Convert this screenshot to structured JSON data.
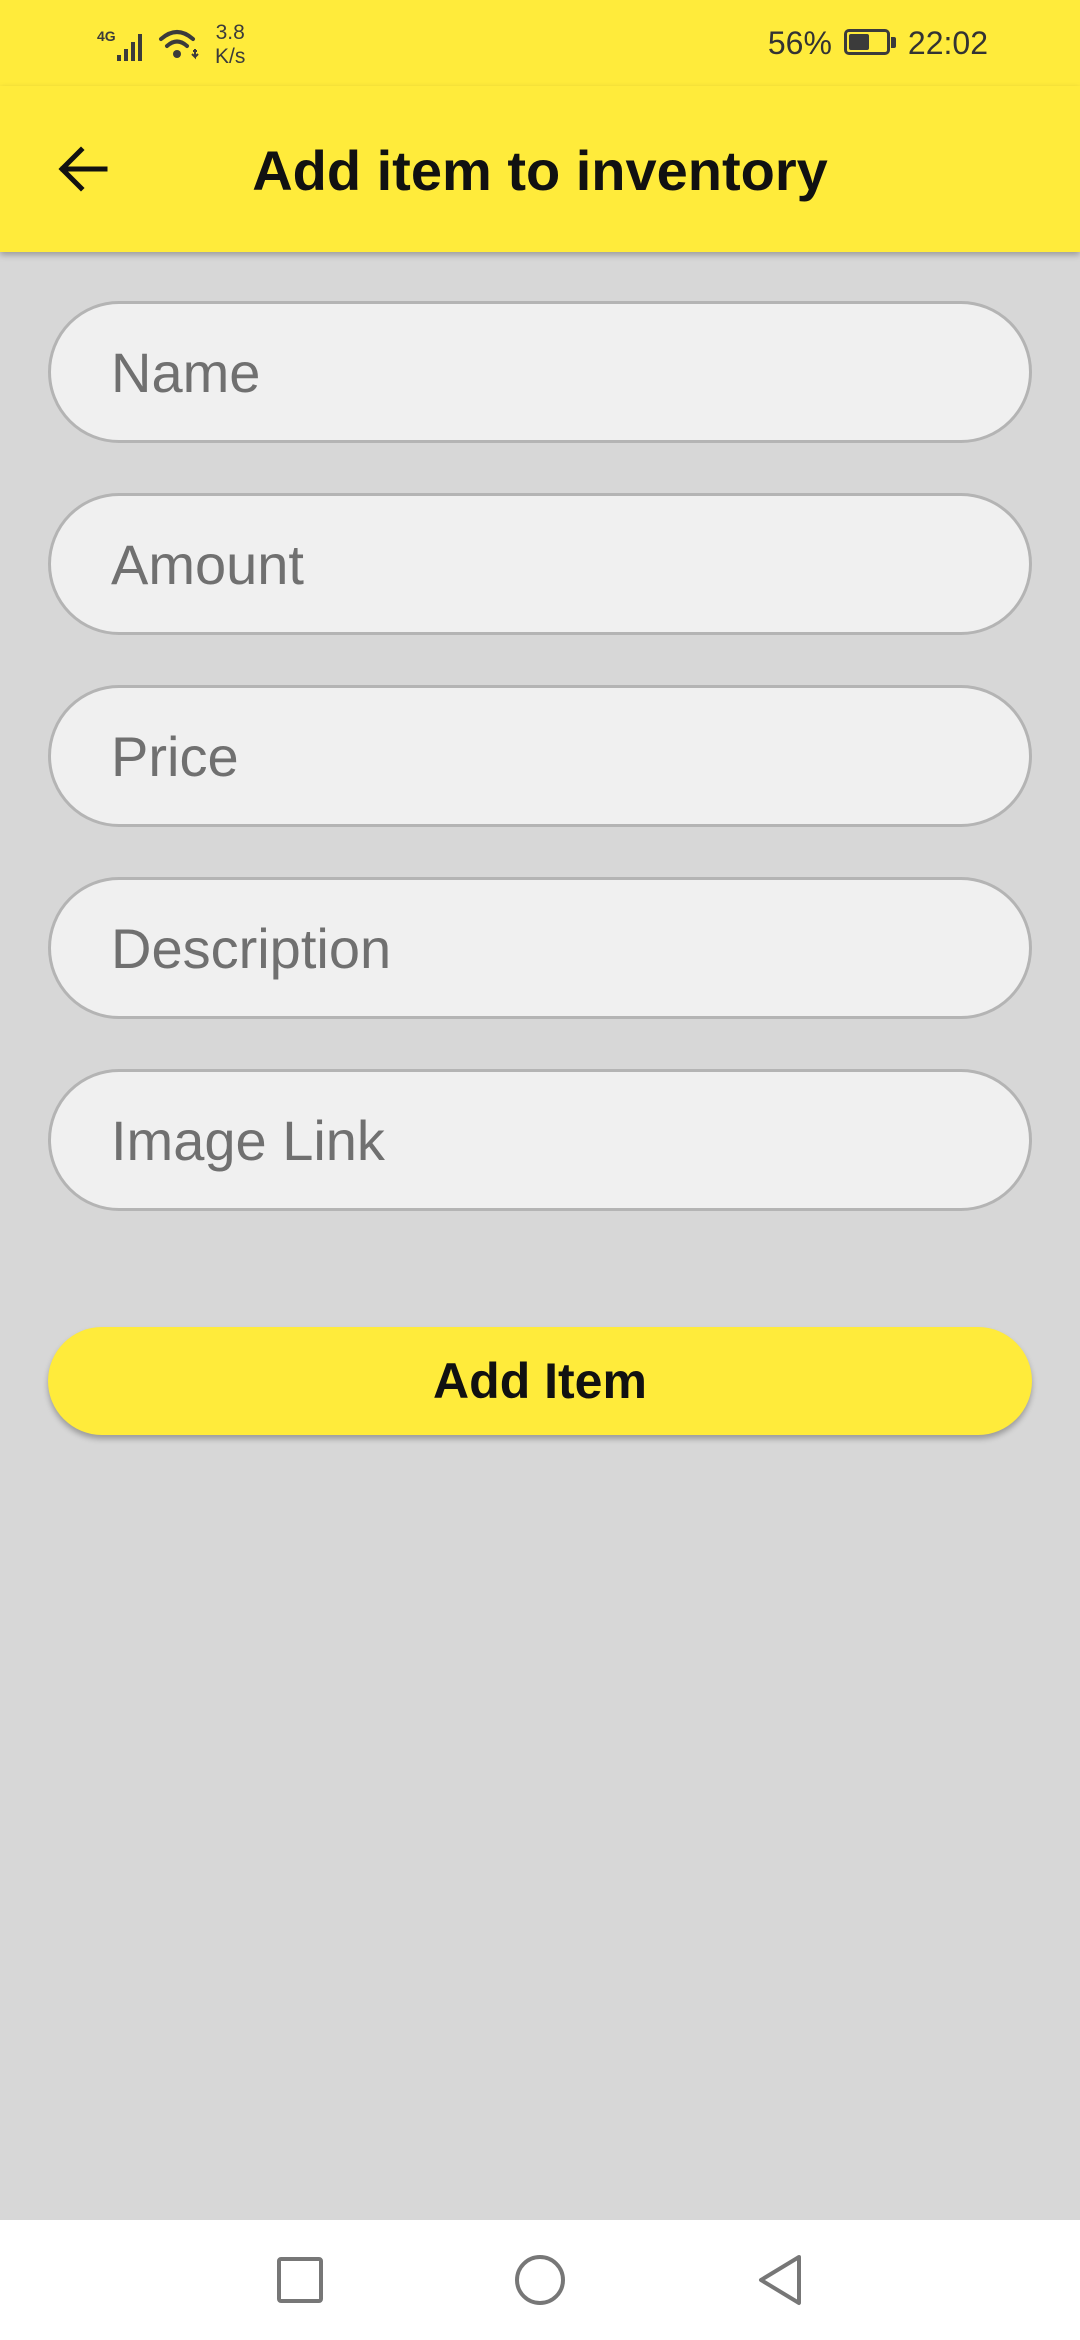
{
  "status_bar": {
    "network_type": "4G",
    "net_speed_value": "3.8",
    "net_speed_unit": "K/s",
    "battery_percent": "56%",
    "time": "22:02",
    "icons": [
      "signal-icon",
      "wifi-icon",
      "battery-icon"
    ]
  },
  "app_bar": {
    "title": "Add item to inventory",
    "back_icon": "arrow-left-icon",
    "color": "#ffeb3b"
  },
  "form": {
    "fields": [
      {
        "placeholder": "Name",
        "value": ""
      },
      {
        "placeholder": "Amount",
        "value": ""
      },
      {
        "placeholder": "Price",
        "value": ""
      },
      {
        "placeholder": "Description",
        "value": ""
      },
      {
        "placeholder": "Image Link",
        "value": ""
      }
    ],
    "submit_label": "Add Item"
  },
  "nav_bar": {
    "icons": [
      "square-recent-apps-icon",
      "circle-home-icon",
      "triangle-back-icon"
    ]
  },
  "colors": {
    "accent": "#ffeb3b",
    "background": "#d7d7d7",
    "field_background": "#f0f0f0",
    "field_border": "#b4b4b4"
  }
}
